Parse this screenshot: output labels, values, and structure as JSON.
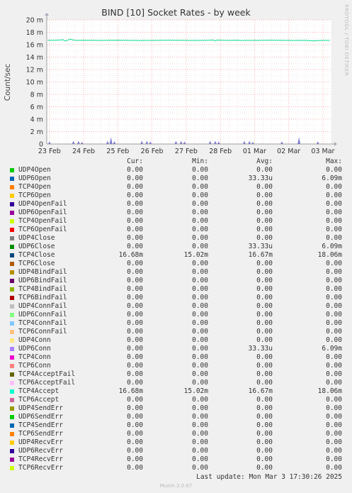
{
  "title": "BIND [10] Socket Rates - by week",
  "side_credit": "RRDTOOL / TOBI OETIKER",
  "legend_headers": {
    "cur": "Cur:",
    "min": "Min:",
    "avg": "Avg:",
    "max": "Max:"
  },
  "last_update": "Last update: Mon Mar  3 17:30:26 2025",
  "version": "Munin 2.0.67",
  "colors": {
    "background": "#f0f0f0",
    "plot": "#ffffff",
    "grid": "#ff9999",
    "main_series": "#22dd99",
    "spikes": "#6666cc"
  },
  "chart_data": {
    "type": "line",
    "title": "BIND [10] Socket Rates - by week",
    "ylabel": "Count/sec",
    "xlabel": "",
    "ylim": [
      0,
      20
    ],
    "y_ticks": [
      0,
      2,
      4,
      6,
      8,
      10,
      12,
      14,
      16,
      18,
      20
    ],
    "y_tick_labels": [
      "0",
      "2 m",
      "4 m",
      "6 m",
      "8 m",
      "10 m",
      "12 m",
      "14 m",
      "16 m",
      "18 m",
      "20 m"
    ],
    "x_tick_labels": [
      "23 Feb",
      "24 Feb",
      "25 Feb",
      "26 Feb",
      "27 Feb",
      "28 Feb",
      "01 Mar",
      "02 Mar",
      "03 Mar"
    ],
    "xlim": [
      -0.08,
      8.25
    ],
    "grid": true,
    "main_series": {
      "name": "TCP4Close / TCP4Accept",
      "x": [
        -0.05,
        0.3,
        0.4,
        0.45,
        0.55,
        0.6,
        0.7,
        0.8,
        1.0,
        1.5,
        2.0,
        2.6,
        3.0,
        3.5,
        4.0,
        4.5,
        4.8,
        4.85,
        4.9,
        5.2,
        5.5,
        5.6,
        5.65,
        6.0,
        6.5,
        7.0,
        7.2,
        7.3,
        7.5,
        7.7,
        8.0,
        8.2
      ],
      "y": [
        16.7,
        16.75,
        16.8,
        16.6,
        16.75,
        16.9,
        16.75,
        16.7,
        16.72,
        16.7,
        16.72,
        16.68,
        16.7,
        16.72,
        16.7,
        16.7,
        16.75,
        16.6,
        16.75,
        16.7,
        16.72,
        16.68,
        16.7,
        16.7,
        16.72,
        16.7,
        16.68,
        16.7,
        16.7,
        16.62,
        16.7,
        16.7
      ]
    },
    "spike_series": {
      "name": "UDP6Open / UDP6Close / UDP6Conn",
      "x": [
        0.0,
        0.7,
        0.85,
        0.95,
        1.7,
        1.8,
        1.9,
        2.7,
        2.85,
        2.95,
        3.7,
        3.85,
        3.95,
        4.7,
        4.85,
        4.95,
        5.7,
        5.85,
        5.95,
        6.8,
        7.3,
        7.85
      ],
      "y": [
        0.4,
        0.5,
        0.5,
        0.35,
        0.5,
        1.1,
        0.45,
        0.5,
        0.5,
        0.4,
        0.5,
        0.5,
        0.4,
        0.5,
        0.5,
        0.4,
        0.5,
        0.5,
        0.35,
        0.4,
        1.1,
        0.4
      ]
    },
    "legend": [
      {
        "name": "UDP4Open",
        "color": "#00cc00",
        "cur": "0.00",
        "min": "0.00",
        "avg": "0.00",
        "max": "0.00"
      },
      {
        "name": "UDP6Open",
        "color": "#0066b3",
        "cur": "0.00",
        "min": "0.00",
        "avg": "33.33u",
        "max": "6.09m"
      },
      {
        "name": "TCP4Open",
        "color": "#ff8000",
        "cur": "0.00",
        "min": "0.00",
        "avg": "0.00",
        "max": "0.00"
      },
      {
        "name": "TCP6Open",
        "color": "#ffcc00",
        "cur": "0.00",
        "min": "0.00",
        "avg": "0.00",
        "max": "0.00"
      },
      {
        "name": "UDP4OpenFail",
        "color": "#330099",
        "cur": "0.00",
        "min": "0.00",
        "avg": "0.00",
        "max": "0.00"
      },
      {
        "name": "UDP6OpenFail",
        "color": "#990099",
        "cur": "0.00",
        "min": "0.00",
        "avg": "0.00",
        "max": "0.00"
      },
      {
        "name": "TCP4OpenFail",
        "color": "#ccff00",
        "cur": "0.00",
        "min": "0.00",
        "avg": "0.00",
        "max": "0.00"
      },
      {
        "name": "TCP6OpenFail",
        "color": "#ff0000",
        "cur": "0.00",
        "min": "0.00",
        "avg": "0.00",
        "max": "0.00"
      },
      {
        "name": "UDP4Close",
        "color": "#808080",
        "cur": "0.00",
        "min": "0.00",
        "avg": "0.00",
        "max": "0.00"
      },
      {
        "name": "UDP6Close",
        "color": "#008f00",
        "cur": "0.00",
        "min": "0.00",
        "avg": "33.33u",
        "max": "6.09m"
      },
      {
        "name": "TCP4Close",
        "color": "#00487d",
        "cur": "16.68m",
        "min": "15.02m",
        "avg": "16.67m",
        "max": "18.06m"
      },
      {
        "name": "TCP6Close",
        "color": "#b35a00",
        "cur": "0.00",
        "min": "0.00",
        "avg": "0.00",
        "max": "0.00"
      },
      {
        "name": "UDP4BindFail",
        "color": "#b38f00",
        "cur": "0.00",
        "min": "0.00",
        "avg": "0.00",
        "max": "0.00"
      },
      {
        "name": "UDP6BindFail",
        "color": "#6b006b",
        "cur": "0.00",
        "min": "0.00",
        "avg": "0.00",
        "max": "0.00"
      },
      {
        "name": "TCP4BindFail",
        "color": "#8fb300",
        "cur": "0.00",
        "min": "0.00",
        "avg": "0.00",
        "max": "0.00"
      },
      {
        "name": "TCP6BindFail",
        "color": "#b30000",
        "cur": "0.00",
        "min": "0.00",
        "avg": "0.00",
        "max": "0.00"
      },
      {
        "name": "UDP4ConnFail",
        "color": "#bebebe",
        "cur": "0.00",
        "min": "0.00",
        "avg": "0.00",
        "max": "0.00"
      },
      {
        "name": "UDP6ConnFail",
        "color": "#80ff80",
        "cur": "0.00",
        "min": "0.00",
        "avg": "0.00",
        "max": "0.00"
      },
      {
        "name": "TCP4ConnFail",
        "color": "#80c9ff",
        "cur": "0.00",
        "min": "0.00",
        "avg": "0.00",
        "max": "0.00"
      },
      {
        "name": "TCP6ConnFail",
        "color": "#ffc080",
        "cur": "0.00",
        "min": "0.00",
        "avg": "0.00",
        "max": "0.00"
      },
      {
        "name": "UDP4Conn",
        "color": "#ffe680",
        "cur": "0.00",
        "min": "0.00",
        "avg": "0.00",
        "max": "0.00"
      },
      {
        "name": "UDP6Conn",
        "color": "#aa80ff",
        "cur": "0.00",
        "min": "0.00",
        "avg": "33.33u",
        "max": "6.09m"
      },
      {
        "name": "TCP4Conn",
        "color": "#ee00cc",
        "cur": "0.00",
        "min": "0.00",
        "avg": "0.00",
        "max": "0.00"
      },
      {
        "name": "TCP6Conn",
        "color": "#ff8080",
        "cur": "0.00",
        "min": "0.00",
        "avg": "0.00",
        "max": "0.00"
      },
      {
        "name": "TCP4AcceptFail",
        "color": "#666600",
        "cur": "0.00",
        "min": "0.00",
        "avg": "0.00",
        "max": "0.00"
      },
      {
        "name": "TCP6AcceptFail",
        "color": "#ffbfff",
        "cur": "0.00",
        "min": "0.00",
        "avg": "0.00",
        "max": "0.00"
      },
      {
        "name": "TCP4Accept",
        "color": "#00ffcc",
        "cur": "16.68m",
        "min": "15.02m",
        "avg": "16.67m",
        "max": "18.06m"
      },
      {
        "name": "TCP6Accept",
        "color": "#cc6699",
        "cur": "0.00",
        "min": "0.00",
        "avg": "0.00",
        "max": "0.00"
      },
      {
        "name": "UDP4SendErr",
        "color": "#999900",
        "cur": "0.00",
        "min": "0.00",
        "avg": "0.00",
        "max": "0.00"
      },
      {
        "name": "UDP6SendErr",
        "color": "#00cc00",
        "cur": "0.00",
        "min": "0.00",
        "avg": "0.00",
        "max": "0.00"
      },
      {
        "name": "TCP4SendErr",
        "color": "#0066b3",
        "cur": "0.00",
        "min": "0.00",
        "avg": "0.00",
        "max": "0.00"
      },
      {
        "name": "TCP6SendErr",
        "color": "#ff8000",
        "cur": "0.00",
        "min": "0.00",
        "avg": "0.00",
        "max": "0.00"
      },
      {
        "name": "UDP4RecvErr",
        "color": "#ffcc00",
        "cur": "0.00",
        "min": "0.00",
        "avg": "0.00",
        "max": "0.00"
      },
      {
        "name": "UDP6RecvErr",
        "color": "#330099",
        "cur": "0.00",
        "min": "0.00",
        "avg": "0.00",
        "max": "0.00"
      },
      {
        "name": "TCP4RecvErr",
        "color": "#990099",
        "cur": "0.00",
        "min": "0.00",
        "avg": "0.00",
        "max": "0.00"
      },
      {
        "name": "TCP6RecvErr",
        "color": "#ccff00",
        "cur": "0.00",
        "min": "0.00",
        "avg": "0.00",
        "max": "0.00"
      }
    ]
  }
}
